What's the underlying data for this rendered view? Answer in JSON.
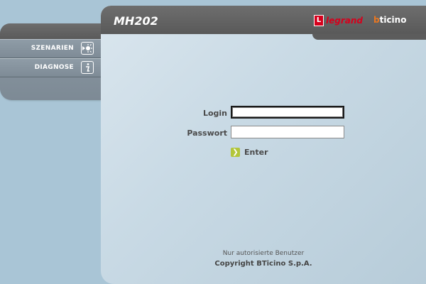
{
  "header": {
    "title": "MH202",
    "brand_legrand": "legrand",
    "brand_legrand_mark": "L",
    "brand_bticino_b": "b",
    "brand_bticino_rest": "ticino"
  },
  "sidebar": {
    "items": [
      {
        "label": "SZENARIEN",
        "icon": "scenario-icon"
      },
      {
        "label": "DIAGNOSE",
        "icon": "info-icon"
      }
    ]
  },
  "login": {
    "login_label": "Login",
    "login_value": "",
    "password_label": "Passwort",
    "password_value": "",
    "enter_label": "Enter"
  },
  "footer": {
    "notice": "Nur autorisierte Benutzer",
    "copyright": "Copyright BTicino S.p.A."
  },
  "colors": {
    "background": "#a9c5d6",
    "topbar": "#5f5f5f",
    "legrand_red": "#d6001c",
    "bticino_orange": "#e87722",
    "enter_green": "#b3c63a"
  }
}
